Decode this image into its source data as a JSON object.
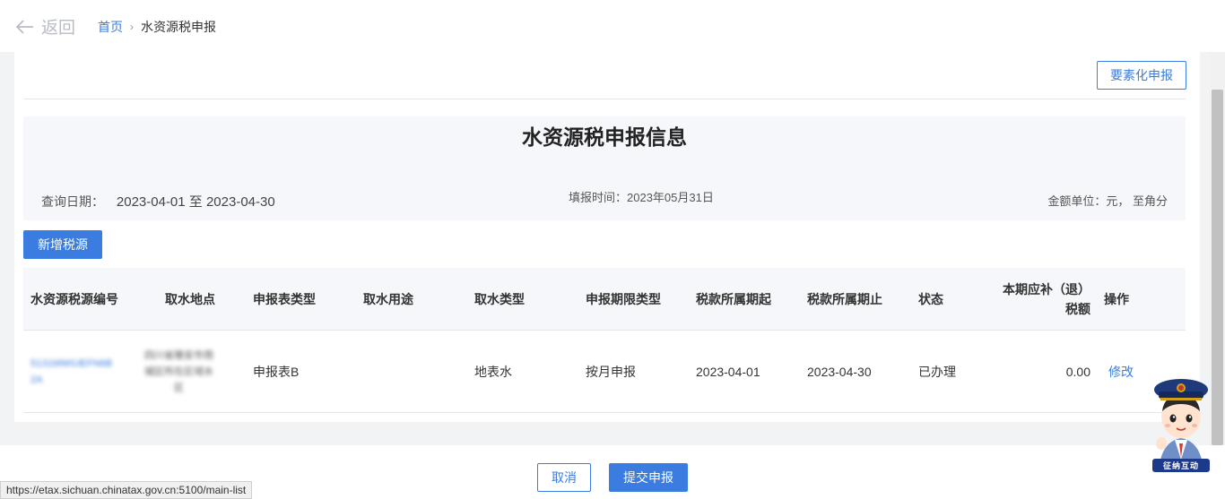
{
  "header": {
    "back_label": "返回",
    "breadcrumb": {
      "home": "首页",
      "separator": "›",
      "current": "水资源税申报"
    }
  },
  "card": {
    "element_button": "要素化申报",
    "info": {
      "title": "水资源税申报信息",
      "query_date_label": "查询日期：",
      "query_date_value": "2023-04-01 至 2023-04-30",
      "fill_time": "填报时间：2023年05月31日",
      "amount_unit": "金额单位：元， 至角分"
    },
    "add_button": "新增税源",
    "table": {
      "columns": [
        "水资源税源编号",
        "取水地点",
        "申报表类型",
        "取水用途",
        "取水类型",
        "申报期限类型",
        "税款所属期起",
        "税款所属期止",
        "状态",
        "本期应补（退）",
        "税额",
        "操作"
      ],
      "rows": [
        {
          "source_id_lines": [
            "5131MW0JEFN6B",
            "2A"
          ],
          "location_lines": [
            "四川省雅安市雨",
            "城区所在区域水",
            "区"
          ],
          "form_type": "申报表B",
          "usage": "",
          "water_type": "地表水",
          "period_type": "按月申报",
          "period_start": "2023-04-01",
          "period_end": "2023-04-30",
          "status": "已办理",
          "tax_amount": "0.00",
          "action": "修改"
        }
      ]
    }
  },
  "footer": {
    "cancel": "取消",
    "submit": "提交申报"
  },
  "status_bar_url": "https://etax.sichuan.chinatax.gov.cn:5100/main-list",
  "mascot": {
    "label": "征纳互动",
    "icon": "tax-officer-mascot-icon"
  },
  "colors": {
    "accent": "#3a7ce0",
    "info_bg": "#f5f7fa",
    "page_bg": "#f2f3f5"
  }
}
